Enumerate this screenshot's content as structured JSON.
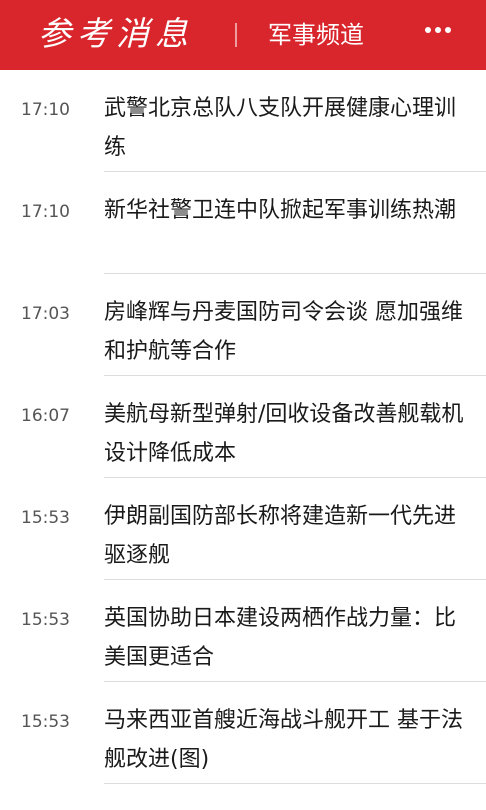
{
  "header": {
    "logo_text": "参考消息",
    "channel_title": "军事频道",
    "more_icon": "more-dots-icon"
  },
  "colors": {
    "header_bg": "#d9262c",
    "text": "#1a1a1a",
    "time": "#555555",
    "separator": "#dcdcdc"
  },
  "news": [
    {
      "time": "17:10",
      "title": "武警北京总队八支队开展健康心理训练"
    },
    {
      "time": "17:10",
      "title": "新华社警卫连中队掀起军事训练热潮"
    },
    {
      "time": "17:03",
      "title": "房峰辉与丹麦国防司令会谈 愿加强维和护航等合作"
    },
    {
      "time": "16:07",
      "title": "美航母新型弹射/回收设备改善舰载机设计降低成本"
    },
    {
      "time": "15:53",
      "title": "伊朗副国防部长称将建造新一代先进驱逐舰"
    },
    {
      "time": "15:53",
      "title": "英国协助日本建设两栖作战力量：比美国更适合"
    },
    {
      "time": "15:53",
      "title": "马来西亚首艘近海战斗舰开工 基于法舰改进(图)"
    }
  ]
}
